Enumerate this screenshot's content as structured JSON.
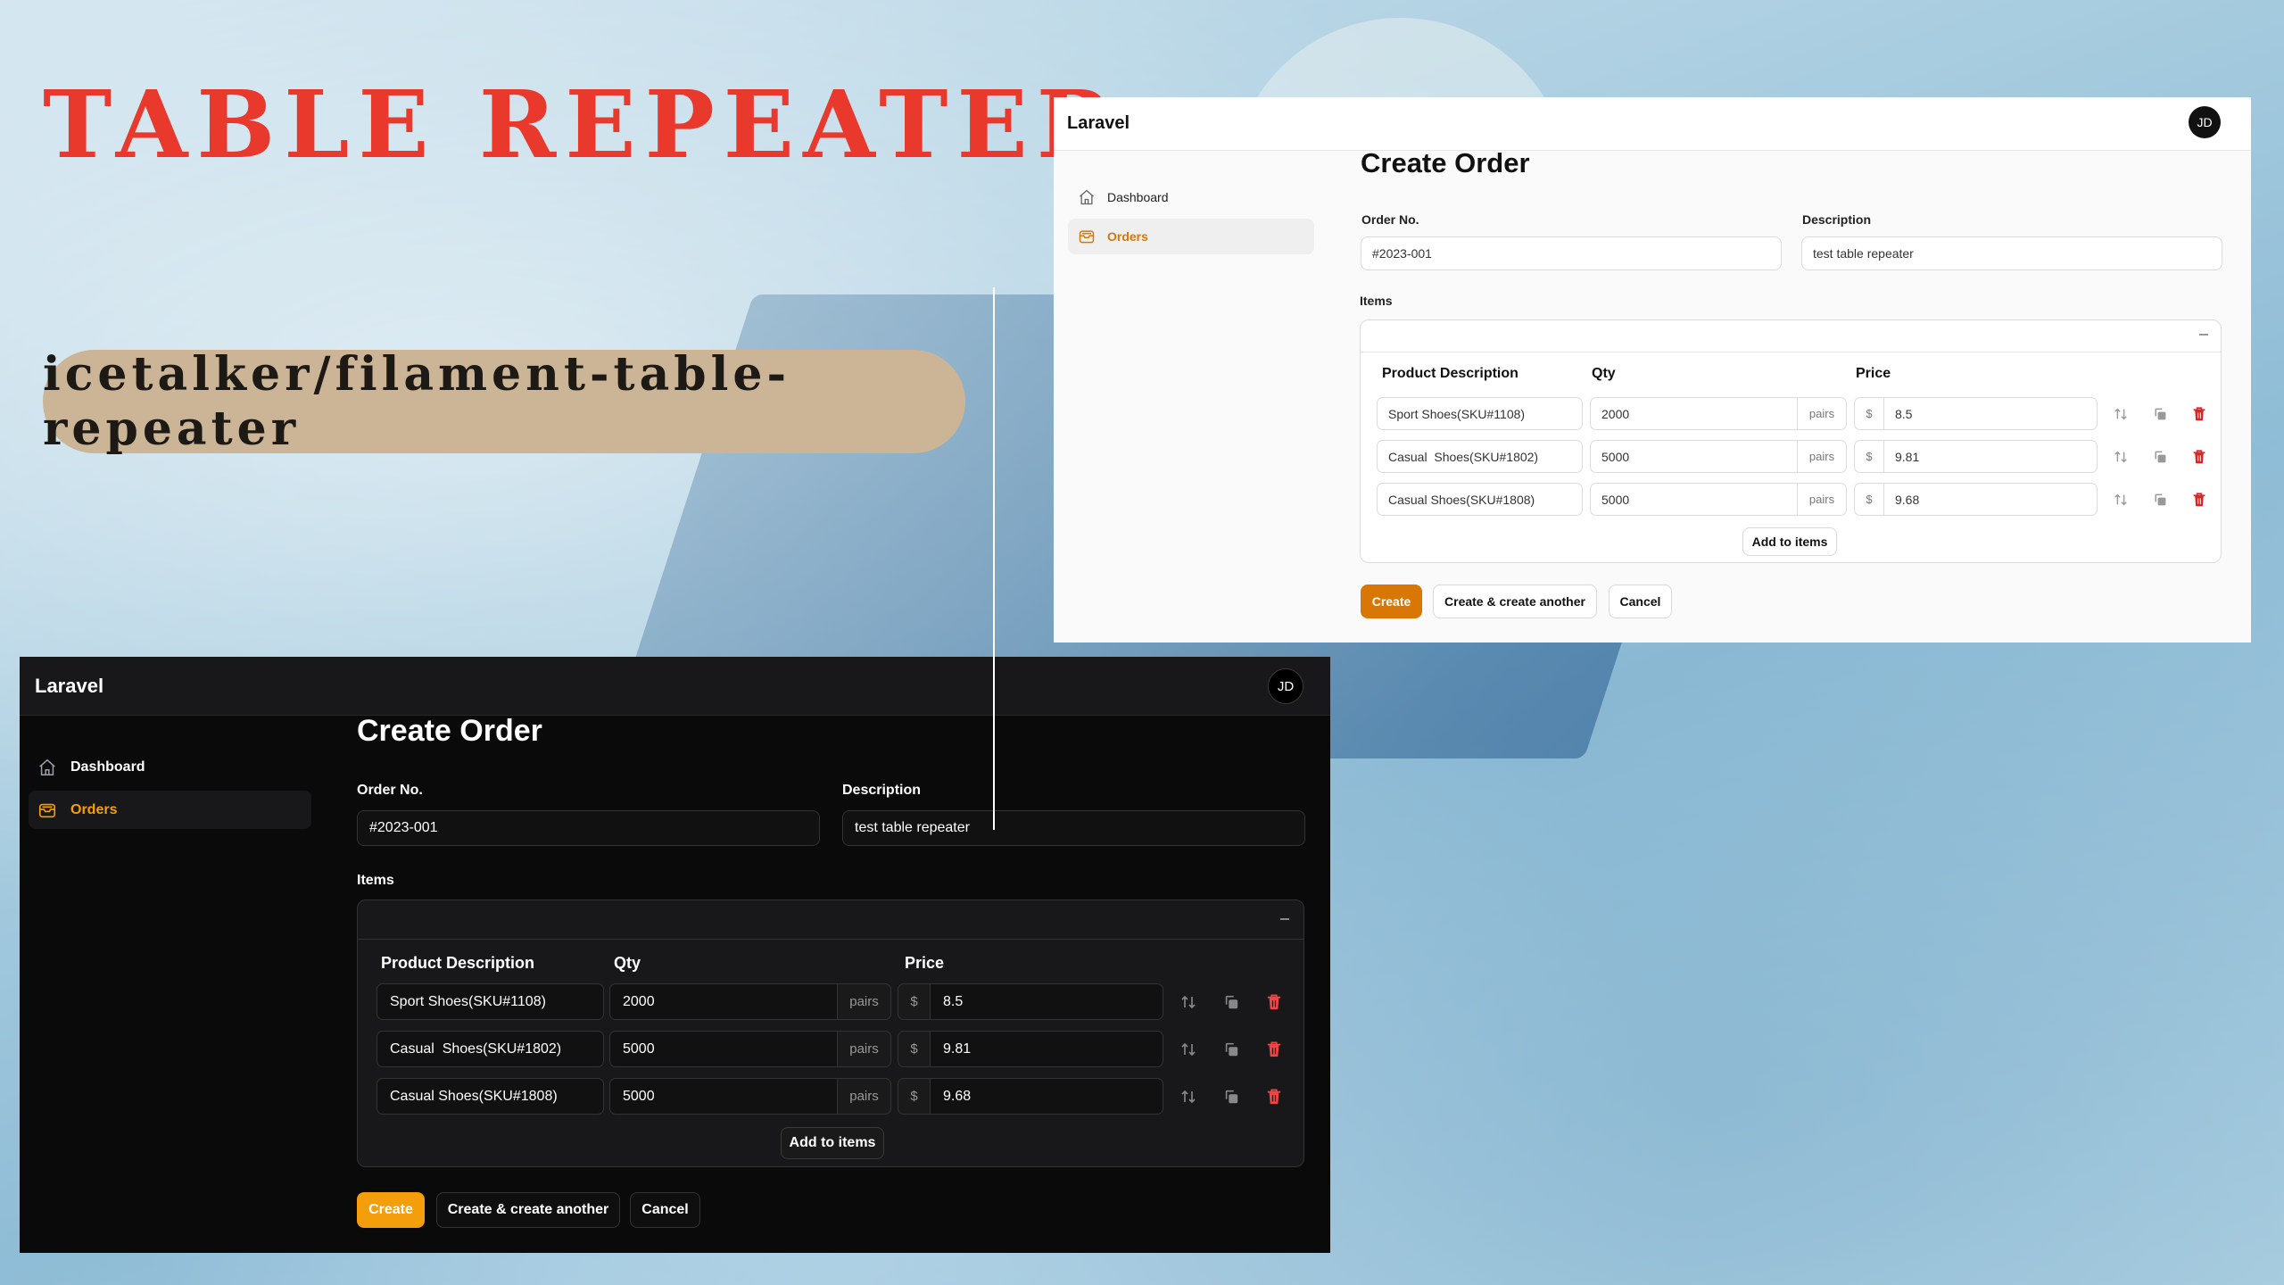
{
  "hero": {
    "title": "TABLE REPEATER",
    "package": "icetalker/filament-table-repeater",
    "title_color": "#e8392c",
    "pill_color": "#cbb596"
  },
  "panels": {
    "light": {
      "brand": "Laravel",
      "avatar": "JD",
      "nav": [
        {
          "label": "Dashboard",
          "icon": "home-icon",
          "active": false
        },
        {
          "label": "Orders",
          "icon": "inbox-icon",
          "active": true
        }
      ],
      "page_title": "Create Order",
      "order_no": {
        "label": "Order No.",
        "value": "#2023-001"
      },
      "description": {
        "label": "Description",
        "value": "test table repeater"
      },
      "items_label": "Items",
      "columns": [
        "Product Description",
        "Qty",
        "Price"
      ],
      "rows": [
        {
          "product": "Sport Shoes(SKU#1108)",
          "qty": "2000",
          "unit": "pairs",
          "currency": "$",
          "price": "8.5"
        },
        {
          "product": "Casual  Shoes(SKU#1802)",
          "qty": "5000",
          "unit": "pairs",
          "currency": "$",
          "price": "9.81"
        },
        {
          "product": "Casual Shoes(SKU#1808)",
          "qty": "5000",
          "unit": "pairs",
          "currency": "$",
          "price": "9.68"
        }
      ],
      "row_actions": [
        "reorder-icon",
        "clone-icon",
        "trash-icon"
      ],
      "add_label": "Add to items",
      "buttons": {
        "create": "Create",
        "create_another": "Create & create another",
        "cancel": "Cancel"
      },
      "accent": "#d97706",
      "danger": "#dc2626"
    },
    "dark": {
      "brand": "Laravel",
      "avatar": "JD",
      "nav": [
        {
          "label": "Dashboard",
          "icon": "home-icon",
          "active": false
        },
        {
          "label": "Orders",
          "icon": "inbox-icon",
          "active": true
        }
      ],
      "page_title": "Create Order",
      "order_no": {
        "label": "Order No.",
        "value": "#2023-001"
      },
      "description": {
        "label": "Description",
        "value": "test table repeater"
      },
      "items_label": "Items",
      "columns": [
        "Product Description",
        "Qty",
        "Price"
      ],
      "rows": [
        {
          "product": "Sport Shoes(SKU#1108)",
          "qty": "2000",
          "unit": "pairs",
          "currency": "$",
          "price": "8.5"
        },
        {
          "product": "Casual  Shoes(SKU#1802)",
          "qty": "5000",
          "unit": "pairs",
          "currency": "$",
          "price": "9.81"
        },
        {
          "product": "Casual Shoes(SKU#1808)",
          "qty": "5000",
          "unit": "pairs",
          "currency": "$",
          "price": "9.68"
        }
      ],
      "row_actions": [
        "reorder-icon",
        "clone-icon",
        "trash-icon"
      ],
      "add_label": "Add to items",
      "buttons": {
        "create": "Create",
        "create_another": "Create & create another",
        "cancel": "Cancel"
      },
      "accent": "#f59e0b",
      "danger": "#ef4444"
    }
  }
}
